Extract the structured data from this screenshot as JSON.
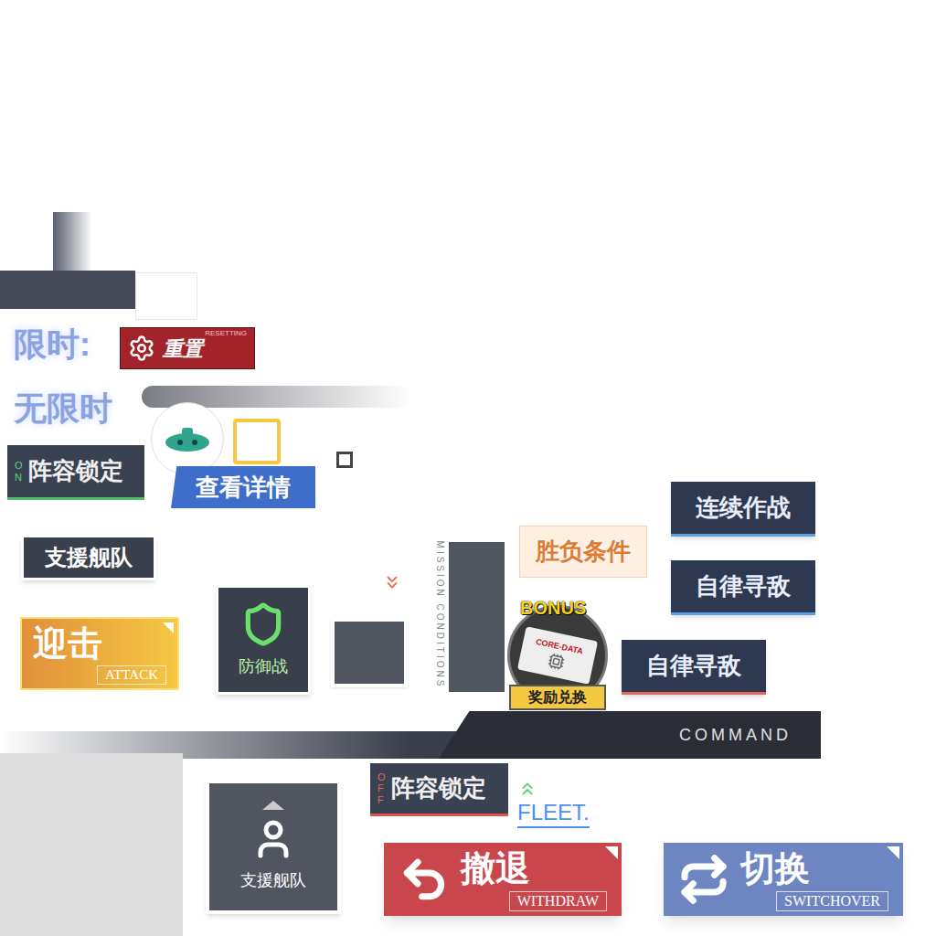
{
  "timers": [
    {
      "label": "限时:"
    },
    {
      "label": "无限时"
    }
  ],
  "reset_button": {
    "badge": "RESETTING",
    "label": "重置"
  },
  "lineup_locks": [
    {
      "indicator": "ON",
      "label": "阵容锁定",
      "on": true
    },
    {
      "indicator": "OFF",
      "label": "阵容锁定",
      "on": false
    }
  ],
  "details_tab": {
    "label": "查看详情"
  },
  "support_fleet": [
    {
      "label": "支援舰队",
      "kind": "plain"
    },
    {
      "label": "支援舰队",
      "kind": "icon"
    }
  ],
  "attack_button": {
    "label": "迎击",
    "sub": "ATTACK"
  },
  "defense_button": {
    "label": "防御战"
  },
  "mission_conditions": {
    "vertical_label": "MISSION CONDITIONS",
    "label": "胜负条件"
  },
  "bonus": {
    "badge": "BONUS",
    "item": "CORE-DATA",
    "label": "奖励兑换"
  },
  "command_buttons": [
    {
      "label": "连续作战",
      "color": "#5aa0e6"
    },
    {
      "label": "自律寻敌",
      "color": "#5aa0e6"
    },
    {
      "label": "自律寻敌",
      "color": "#e06a5a"
    }
  ],
  "command_bar": {
    "label": "COMMAND"
  },
  "fleet_label": {
    "label": "FLEET."
  },
  "action_buttons": [
    {
      "label": "撤退",
      "sub": "WITHDRAW",
      "color": "#c9474c"
    },
    {
      "label": "切换",
      "sub": "SWITCHOVER",
      "color": "#6d86c2"
    }
  ]
}
